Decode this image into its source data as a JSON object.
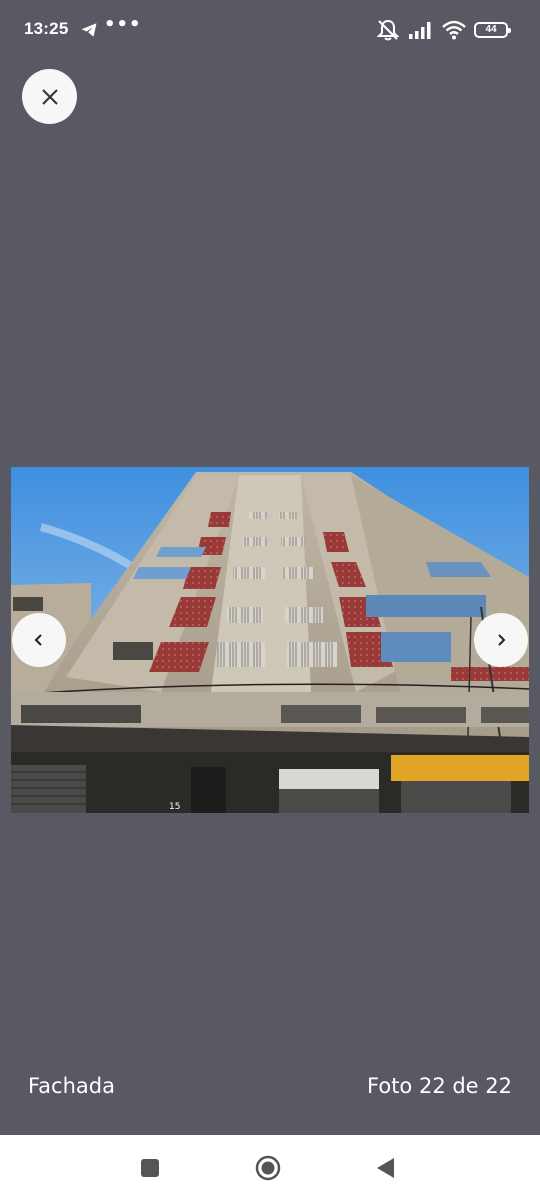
{
  "status_bar": {
    "time": "13:25",
    "more_glyph": "•••",
    "battery_level": "44",
    "icons": [
      "telegram-icon",
      "muted-bell-icon",
      "signal-icon",
      "wifi-icon",
      "battery-icon"
    ]
  },
  "viewer": {
    "close_icon": "close-icon",
    "prev_icon": "chevron-left-icon",
    "next_icon": "chevron-right-icon",
    "photo": {
      "subject": "building-facade-photo",
      "door_number": "15"
    },
    "caption": "Fachada",
    "counter": "Foto 22 de 22"
  },
  "system_nav": {
    "icons": [
      "recents-square-icon",
      "home-circle-icon",
      "back-triangle-icon"
    ]
  },
  "colors": {
    "background": "#585962",
    "button_bg": "#f7f7f7",
    "nav_bar": "#ffffff",
    "text": "#ffffff",
    "nav_icon": "#555555"
  }
}
